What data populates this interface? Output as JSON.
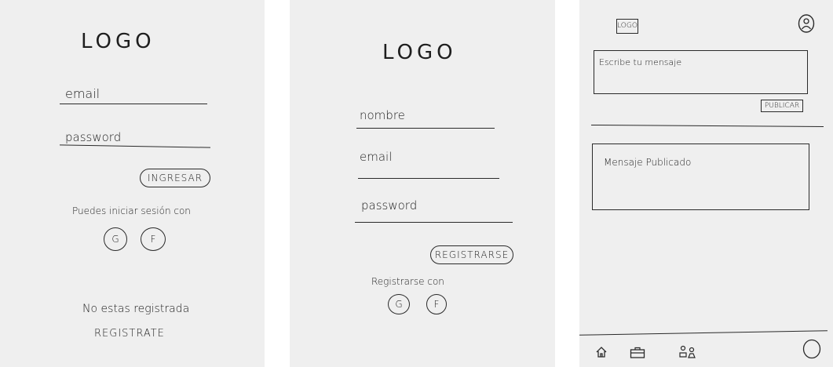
{
  "screens": {
    "login": {
      "logo": "LOGO",
      "email_label": "email",
      "password_label": "password",
      "login_button": "INGRESAR",
      "social_text": "Puedes iniciar sesión con",
      "google_label": "G",
      "facebook_label": "F",
      "not_registered": "No estas registrada",
      "register_link": "REGISTRATE"
    },
    "register": {
      "logo": "LOGO",
      "name_label": "nombre",
      "email_label": "email",
      "password_label": "password",
      "register_button": "REGISTRARSE",
      "social_text": "Registrarse con",
      "google_label": "G",
      "facebook_label": "F"
    },
    "feed": {
      "logo": "LOGO",
      "compose_placeholder": "Escribe tu mensaje",
      "publish_button": "PUBLICAR",
      "published_message": "Mensaje Publicado",
      "nav": [
        "home-icon",
        "briefcase-icon",
        "group-icon",
        "circle-icon"
      ]
    }
  }
}
